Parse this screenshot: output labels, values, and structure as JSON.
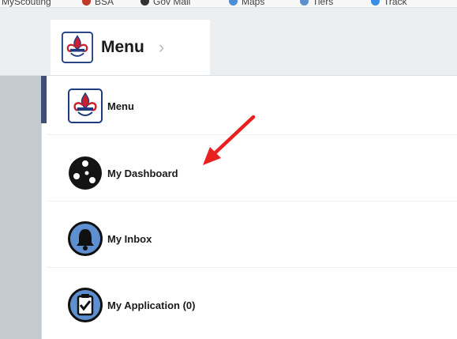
{
  "bookmarks": [
    {
      "label": "MyScouting",
      "icon": "bookmark-icon",
      "color": "#cccccc"
    },
    {
      "label": "BSA",
      "icon": "fleur-de-lis-icon",
      "color": "#c0392b"
    },
    {
      "label": "Gov Mail",
      "icon": "gear-icon",
      "color": "#333333"
    },
    {
      "label": "Maps",
      "icon": "map-icon",
      "color": "#4a8fd8"
    },
    {
      "label": "Tiers",
      "icon": "link-icon",
      "color": "#5a8fd0"
    },
    {
      "label": "Track",
      "icon": "star-icon",
      "color": "#3a8ee6"
    }
  ],
  "top_menu": {
    "label": "Menu",
    "chevron": "›"
  },
  "nav": {
    "items": [
      {
        "label": "Menu",
        "icon": "bsa-emblem-icon"
      },
      {
        "label": "My Dashboard",
        "icon": "dashboard-icon"
      },
      {
        "label": "My Inbox",
        "icon": "bell-icon"
      },
      {
        "label": "My Application (0)",
        "icon": "clipboard-check-icon"
      }
    ]
  },
  "annotation": {
    "type": "arrow",
    "color": "#e8201f",
    "target": "My Dashboard"
  },
  "colors": {
    "accent": "#3e4f72",
    "top_bar": "#eceef2",
    "side_strip": "#c5c9d0",
    "bsa_red": "#c8202f",
    "bsa_blue": "#1f3b80"
  }
}
